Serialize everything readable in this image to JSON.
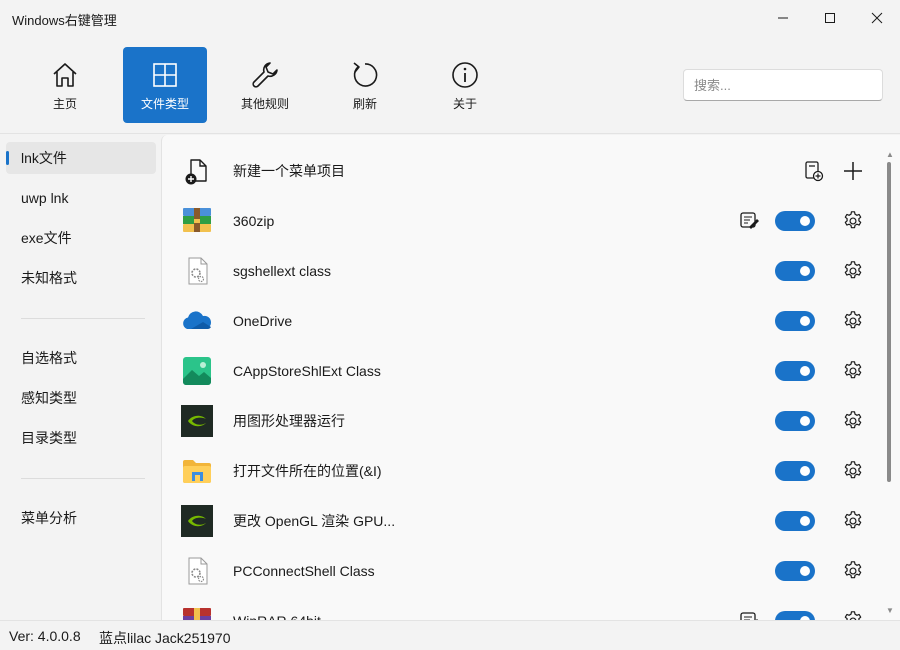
{
  "window": {
    "title": "Windows右键管理"
  },
  "toolbar": {
    "items": [
      {
        "label": "主页",
        "icon": "home-icon"
      },
      {
        "label": "文件类型",
        "icon": "grid-icon",
        "active": true
      },
      {
        "label": "其他规则",
        "icon": "wrench-icon"
      },
      {
        "label": "刷新",
        "icon": "refresh-icon"
      },
      {
        "label": "关于",
        "icon": "info-icon"
      }
    ],
    "search_placeholder": "搜索..."
  },
  "sidebar": {
    "group1": [
      "lnk文件",
      "uwp lnk",
      "exe文件",
      "未知格式"
    ],
    "group2": [
      "自选格式",
      "感知类型",
      "目录类型"
    ],
    "group3": [
      "菜单分析"
    ],
    "active": "lnk文件"
  },
  "list": {
    "new_item": {
      "label": "新建一个菜单项目",
      "icon": "new-file-icon"
    },
    "items": [
      {
        "name": "360zip",
        "icon": "winrar-icon",
        "enabled": true,
        "has_edit": true
      },
      {
        "name": "sgshellext class",
        "icon": "system-file-icon",
        "enabled": true
      },
      {
        "name": "OneDrive",
        "icon": "onedrive-icon",
        "enabled": true
      },
      {
        "name": "CAppStoreShlExt Class",
        "icon": "store-image-icon",
        "enabled": true
      },
      {
        "name": "用图形处理器运行",
        "icon": "nvidia-icon",
        "enabled": true
      },
      {
        "name": "打开文件所在的位置(&I)",
        "icon": "folder-icon",
        "enabled": true
      },
      {
        "name": "更改 OpenGL 渲染 GPU...",
        "icon": "nvidia-icon",
        "enabled": true
      },
      {
        "name": "PCConnectShell Class",
        "icon": "system-file-icon",
        "enabled": true
      },
      {
        "name": "WinRAR 64bit",
        "icon": "winrar-icon",
        "enabled": true,
        "has_edit": true
      }
    ]
  },
  "status": {
    "version": "Ver: 4.0.0.8",
    "author": "蓝点lilac Jack251970"
  },
  "colors": {
    "accent": "#1a73c9"
  }
}
